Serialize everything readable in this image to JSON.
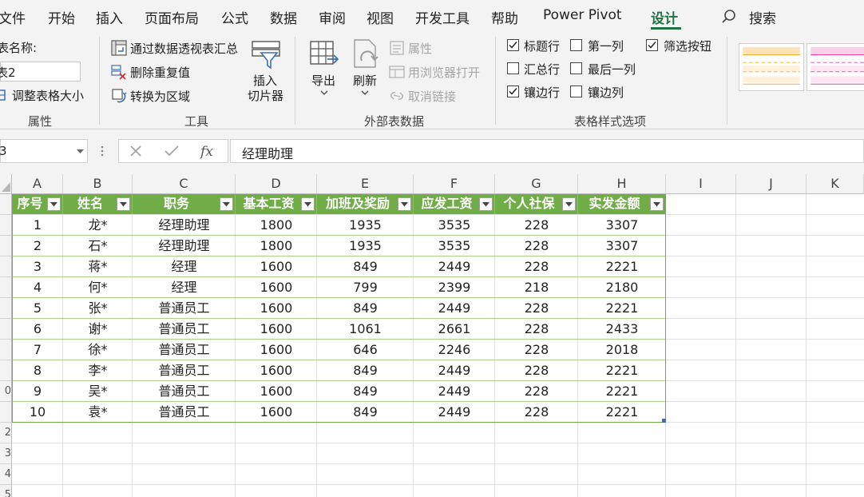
{
  "tabs": [
    "文件",
    "开始",
    "插入",
    "页面布局",
    "公式",
    "数据",
    "审阅",
    "视图",
    "开发工具",
    "帮助",
    "Power Pivot",
    "设计"
  ],
  "active_tab": "设计",
  "search_label": "搜索",
  "properties": {
    "name_label": "表名称:",
    "name_value": "表2",
    "resize_label": "调整表格大小",
    "group_label": "属性"
  },
  "tools": {
    "pivot_label": "通过数据透视表汇总",
    "remove_dup_label": "删除重复值",
    "convert_label": "转换为区域",
    "slicer_label_1": "插入",
    "slicer_label_2": "切片器",
    "group_label": "工具"
  },
  "external": {
    "export_label": "导出",
    "refresh_label": "刷新",
    "properties_label": "属性",
    "browser_label": "用浏览器打开",
    "unlink_label": "取消链接",
    "group_label": "外部表数据"
  },
  "style_options": {
    "header_row": {
      "label": "标题行",
      "checked": true
    },
    "total_row": {
      "label": "汇总行",
      "checked": false
    },
    "banded_rows": {
      "label": "镶边行",
      "checked": true
    },
    "first_column": {
      "label": "第一列",
      "checked": false
    },
    "last_column": {
      "label": "最后一列",
      "checked": false
    },
    "banded_columns": {
      "label": "镶边列",
      "checked": false
    },
    "filter_button": {
      "label": "筛选按钮",
      "checked": true
    },
    "group_label": "表格样式选项"
  },
  "formula_bar": {
    "name_box": "3",
    "formula": "经理助理"
  },
  "columns": [
    "A",
    "B",
    "C",
    "D",
    "E",
    "F",
    "G",
    "H",
    "I",
    "J",
    "K"
  ],
  "row_numbers": [
    "",
    "",
    "",
    "",
    "",
    "",
    "",
    "",
    "",
    "0",
    "",
    "2",
    "3",
    "4",
    "5"
  ],
  "table": {
    "headers": [
      "序号",
      "姓名",
      "职务",
      "基本工资",
      "加班及奖励",
      "应发工资",
      "个人社保",
      "实发金额"
    ],
    "rows": [
      [
        "1",
        "龙*",
        "经理助理",
        "1800",
        "1935",
        "3535",
        "228",
        "3307"
      ],
      [
        "2",
        "石*",
        "经理助理",
        "1800",
        "1935",
        "3535",
        "228",
        "3307"
      ],
      [
        "3",
        "蒋*",
        "经理",
        "1600",
        "849",
        "2449",
        "228",
        "2221"
      ],
      [
        "4",
        "何*",
        "经理",
        "1600",
        "799",
        "2399",
        "218",
        "2180"
      ],
      [
        "5",
        "张*",
        "普通员工",
        "1600",
        "849",
        "2449",
        "228",
        "2221"
      ],
      [
        "6",
        "谢*",
        "普通员工",
        "1600",
        "1061",
        "2661",
        "228",
        "2433"
      ],
      [
        "7",
        "徐*",
        "普通员工",
        "1600",
        "646",
        "2246",
        "228",
        "2018"
      ],
      [
        "8",
        "李*",
        "普通员工",
        "1600",
        "849",
        "2449",
        "228",
        "2221"
      ],
      [
        "9",
        "吴*",
        "普通员工",
        "1600",
        "849",
        "2449",
        "228",
        "2221"
      ],
      [
        "10",
        "袁*",
        "普通员工",
        "1600",
        "849",
        "2449",
        "228",
        "2221"
      ]
    ]
  },
  "colors": {
    "accent": "#217346",
    "table_header": "#70ad47",
    "band_border": "#a9d08e"
  }
}
